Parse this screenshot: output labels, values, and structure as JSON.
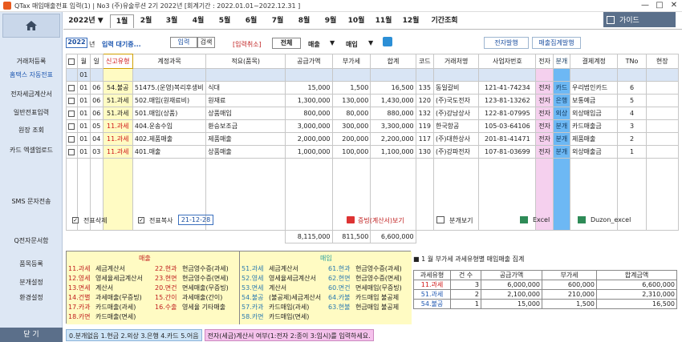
{
  "window": {
    "title": "QTax 매입매출전표 입력(1) | No3 (주)유술루션 2기 2022년 [회계기간 : 2022.01.01~2022.12.31 ]",
    "minimize": "—",
    "maximize": "□",
    "close": "✕"
  },
  "sidebar": {
    "items": [
      "거래처등록",
      "홈택스 자동전표",
      "전자세금계산서",
      "일반전표입력",
      "원장 조회",
      "카드 엑셀업로드",
      "SMS 문자전송",
      "Q전자문서함",
      "품목등록",
      "분개설정",
      "환경설정"
    ],
    "close": "닫 기"
  },
  "monthbar": {
    "year": "2022년 ▼",
    "months": [
      "1월",
      "2월",
      "3월",
      "4월",
      "5월",
      "6월",
      "7월",
      "8월",
      "9월",
      "10월",
      "11월",
      "12월",
      "기간조회"
    ],
    "active": "1월",
    "guide": "가이드"
  },
  "controls": {
    "year_value": "2022",
    "year_suffix": "년",
    "waiting": "입력 대기중...",
    "seg_input": "입력",
    "seg_search": "검색",
    "cancel": "[입력취소]",
    "all": "전체",
    "sales": "매출",
    "purchase": "매입",
    "issue_btn": "전자발행",
    "summary_btn": "매출집계발행"
  },
  "table": {
    "headers": [
      "☐",
      "월",
      "일",
      "신고유형",
      "계정과목",
      "적요(품목)",
      "공급가액",
      "부가세",
      "합계",
      "코드",
      "거래처명",
      "사업자번호",
      "전자",
      "분개",
      "결제계정",
      "TNo",
      "현장"
    ],
    "input_month": "01",
    "rows": [
      {
        "m": "01",
        "d": "06",
        "type": "54.불공",
        "account": "51475.(운영)복리후생비",
        "memo": "식대",
        "supply": "15,000",
        "vat": "1,500",
        "total": "16,500",
        "code": "135",
        "client": "동일갈비",
        "bizno": "121-41-74234",
        "e": "전자",
        "j": "카드",
        "pay": "우리법인카드",
        "tno": "6"
      },
      {
        "m": "01",
        "d": "06",
        "type": "51.과세",
        "account": "502.매입(원재료비)",
        "memo": "원재료",
        "supply": "1,300,000",
        "vat": "130,000",
        "total": "1,430,000",
        "code": "120",
        "client": "(주)국도전자",
        "bizno": "123-81-13262",
        "e": "전자",
        "j": "은행",
        "pay": "보통예금",
        "tno": "5"
      },
      {
        "m": "01",
        "d": "06",
        "type": "51.과세",
        "account": "501.매입(상품)",
        "memo": "상품매입",
        "supply": "800,000",
        "vat": "80,000",
        "total": "880,000",
        "code": "132",
        "client": "(주)강남상사",
        "bizno": "122-81-07995",
        "e": "전자",
        "j": "외상",
        "pay": "외상매입금",
        "tno": "4"
      },
      {
        "m": "01",
        "d": "05",
        "type": "11.과세",
        "account": "404.운송수입",
        "memo": "환승보조금",
        "supply": "3,000,000",
        "vat": "300,000",
        "total": "3,300,000",
        "code": "119",
        "client": "한국항공",
        "bizno": "105-03-64106",
        "e": "전자",
        "j": "분개",
        "pay": "카드매출금",
        "tno": "3"
      },
      {
        "m": "01",
        "d": "04",
        "type": "11.과세",
        "account": "402.제품매출",
        "memo": "제품매출",
        "supply": "2,000,000",
        "vat": "200,000",
        "total": "2,200,000",
        "code": "117",
        "client": "(주)대한상사",
        "bizno": "201-81-41471",
        "e": "전자",
        "j": "분개",
        "pay": "제품매출",
        "tno": "2"
      },
      {
        "m": "01",
        "d": "03",
        "type": "11.과세",
        "account": "401.매출",
        "memo": "상품매출",
        "supply": "1,000,000",
        "vat": "100,000",
        "total": "1,100,000",
        "code": "130",
        "client": "(주)강파전자",
        "bizno": "107-81-03699",
        "e": "전자",
        "j": "분개",
        "pay": "외상매출금",
        "tno": "1"
      }
    ],
    "totals": {
      "supply": "8,115,000",
      "vat": "811,500",
      "total": "6,600,000"
    }
  },
  "bottom": {
    "del": "전표삭제",
    "copy": "전표복사",
    "date": "21-12-28",
    "view": "증빙(계산서)보기",
    "journal": "분개보기",
    "excel": "Excel",
    "duzon": "Duzon_excel"
  },
  "legend": {
    "sales_title": "매출",
    "purchase_title": "매입",
    "s1": [
      "11.과세",
      "12.영세",
      "13.면세",
      "14.건별",
      "17.카과",
      "18.카면"
    ],
    "s2": [
      "세금계산서",
      "영세율세금계산서",
      "계산서",
      "과세매출(무증빙)",
      "카드매출(과세)",
      "카드매출(면세)"
    ],
    "s3": [
      "22.현과",
      "23.현면",
      "20.면건",
      "15.간이",
      "16.수출"
    ],
    "s4": [
      "현금영수증(과세)",
      "현금영수증(면세)",
      "면세매출(무증빙)",
      "과세매출(간이)",
      "영세율 기타매출"
    ],
    "p1": [
      "51.과세",
      "52.영세",
      "53.면세",
      "54.불공",
      "57.카과",
      "58.카면"
    ],
    "p2": [
      "세금계산서",
      "영세율세금계산서",
      "계산서",
      "(불공제)세금계산서",
      "카드매입(과세)",
      "카드매입(면세)"
    ],
    "p3": [
      "61.현과",
      "62.현면",
      "60.면건",
      "64.카불",
      "63.현불"
    ],
    "p4": [
      "현금영수증(과세)",
      "현금영수증(면세)",
      "면세매입(무증빙)",
      "카드매입 불공제",
      "현금매입 불공제"
    ]
  },
  "summary": {
    "title": "■ 1 월  부가세 과세유형별 매입매출 집계",
    "headers": [
      "과세유형",
      "건 수",
      "공급가액",
      "부가세",
      "합계금액"
    ],
    "rows": [
      [
        "11.과세",
        "3",
        "6,000,000",
        "600,000",
        "6,600,000"
      ],
      [
        "51.과세",
        "2",
        "2,100,000",
        "210,000",
        "2,310,000"
      ],
      [
        "54.불공",
        "1",
        "15,000",
        "1,500",
        "16,500"
      ]
    ]
  },
  "status": {
    "left": "0.분개없음 1.현금 2.외상 3.은행 4.카드 5.어음",
    "right": "전자(세금)계산서 여부(1:전자 2:종이 3:임시)를 입력하세요."
  },
  "colors": {
    "sidebar": "#dde7f4",
    "highlight_yellow": "#fffbc3",
    "pink": "#f5d0ee",
    "blue": "#6db8f4",
    "red": "#d01515"
  }
}
